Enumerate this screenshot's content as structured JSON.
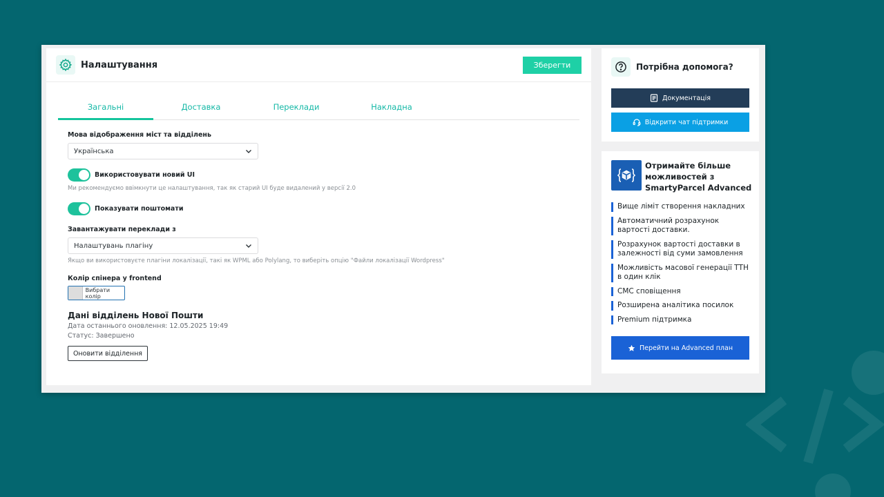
{
  "colors": {
    "background": "#04666f",
    "accent": "#1ed0a6",
    "tab_text": "#14b8a6",
    "doc_button": "#233d58",
    "chat_button": "#0aa0e4",
    "advanced_button": "#1a62d6"
  },
  "header": {
    "icon": "gear-icon",
    "title": "Налаштування",
    "save_label": "Зберегти"
  },
  "tabs": [
    {
      "label": "Загальні",
      "active": true
    },
    {
      "label": "Доставка",
      "active": false
    },
    {
      "label": "Переклади",
      "active": false
    },
    {
      "label": "Накладна",
      "active": false
    }
  ],
  "general": {
    "city_language": {
      "label": "Мова відображення міст та відділень",
      "value": "Українська"
    },
    "new_ui": {
      "label": "Використовувати новий UI",
      "enabled": true,
      "hint": "Ми рекомендуємо ввімкнути це налаштування, так як старий UI буде видалений у версії 2.0"
    },
    "show_postomats": {
      "label": "Показувати поштомати",
      "enabled": true
    },
    "translations_source": {
      "label": "Завантажувати переклади з",
      "value": "Налаштувань плагіну",
      "hint": "Якщо ви використовуєте плагіни локалізації, такі як WPML або Polylang, то виберіть опцію \"Файли локалізації Wordpress\""
    },
    "spinner_color": {
      "label": "Колір спінера у frontend",
      "button_label": "Вибрати колір",
      "value": "#dddddd"
    },
    "np_data": {
      "title": "Дані відділень Нової Пошти",
      "last_update": "Дата останнього оновлення: 12.05.2025 19:49",
      "status": "Статус: Завершено",
      "refresh_label": "Оновити відділення"
    }
  },
  "help": {
    "icon": "question-icon",
    "title": "Потрібна допомога?",
    "docs_label": "Документація",
    "docs_icon": "document-icon",
    "chat_label": "Відкрити чат підтримки",
    "chat_icon": "headset-icon"
  },
  "advanced": {
    "logo_icon": "package-icon",
    "title": "Отримайте більше можливостей з SmartyParcel Advanced",
    "features": [
      "Вище ліміт створення накладних",
      "Автоматичний розрахунок вартості доставки.",
      "Розрахунок вартості доставки в залежності від суми замовлення",
      "Можливість масової генерації ТТН в один клік",
      "СМС сповіщення",
      "Розширена аналітика посилок",
      "Premium підтримка"
    ],
    "button_label": "Перейти на Advanced план",
    "button_icon": "star-icon"
  }
}
